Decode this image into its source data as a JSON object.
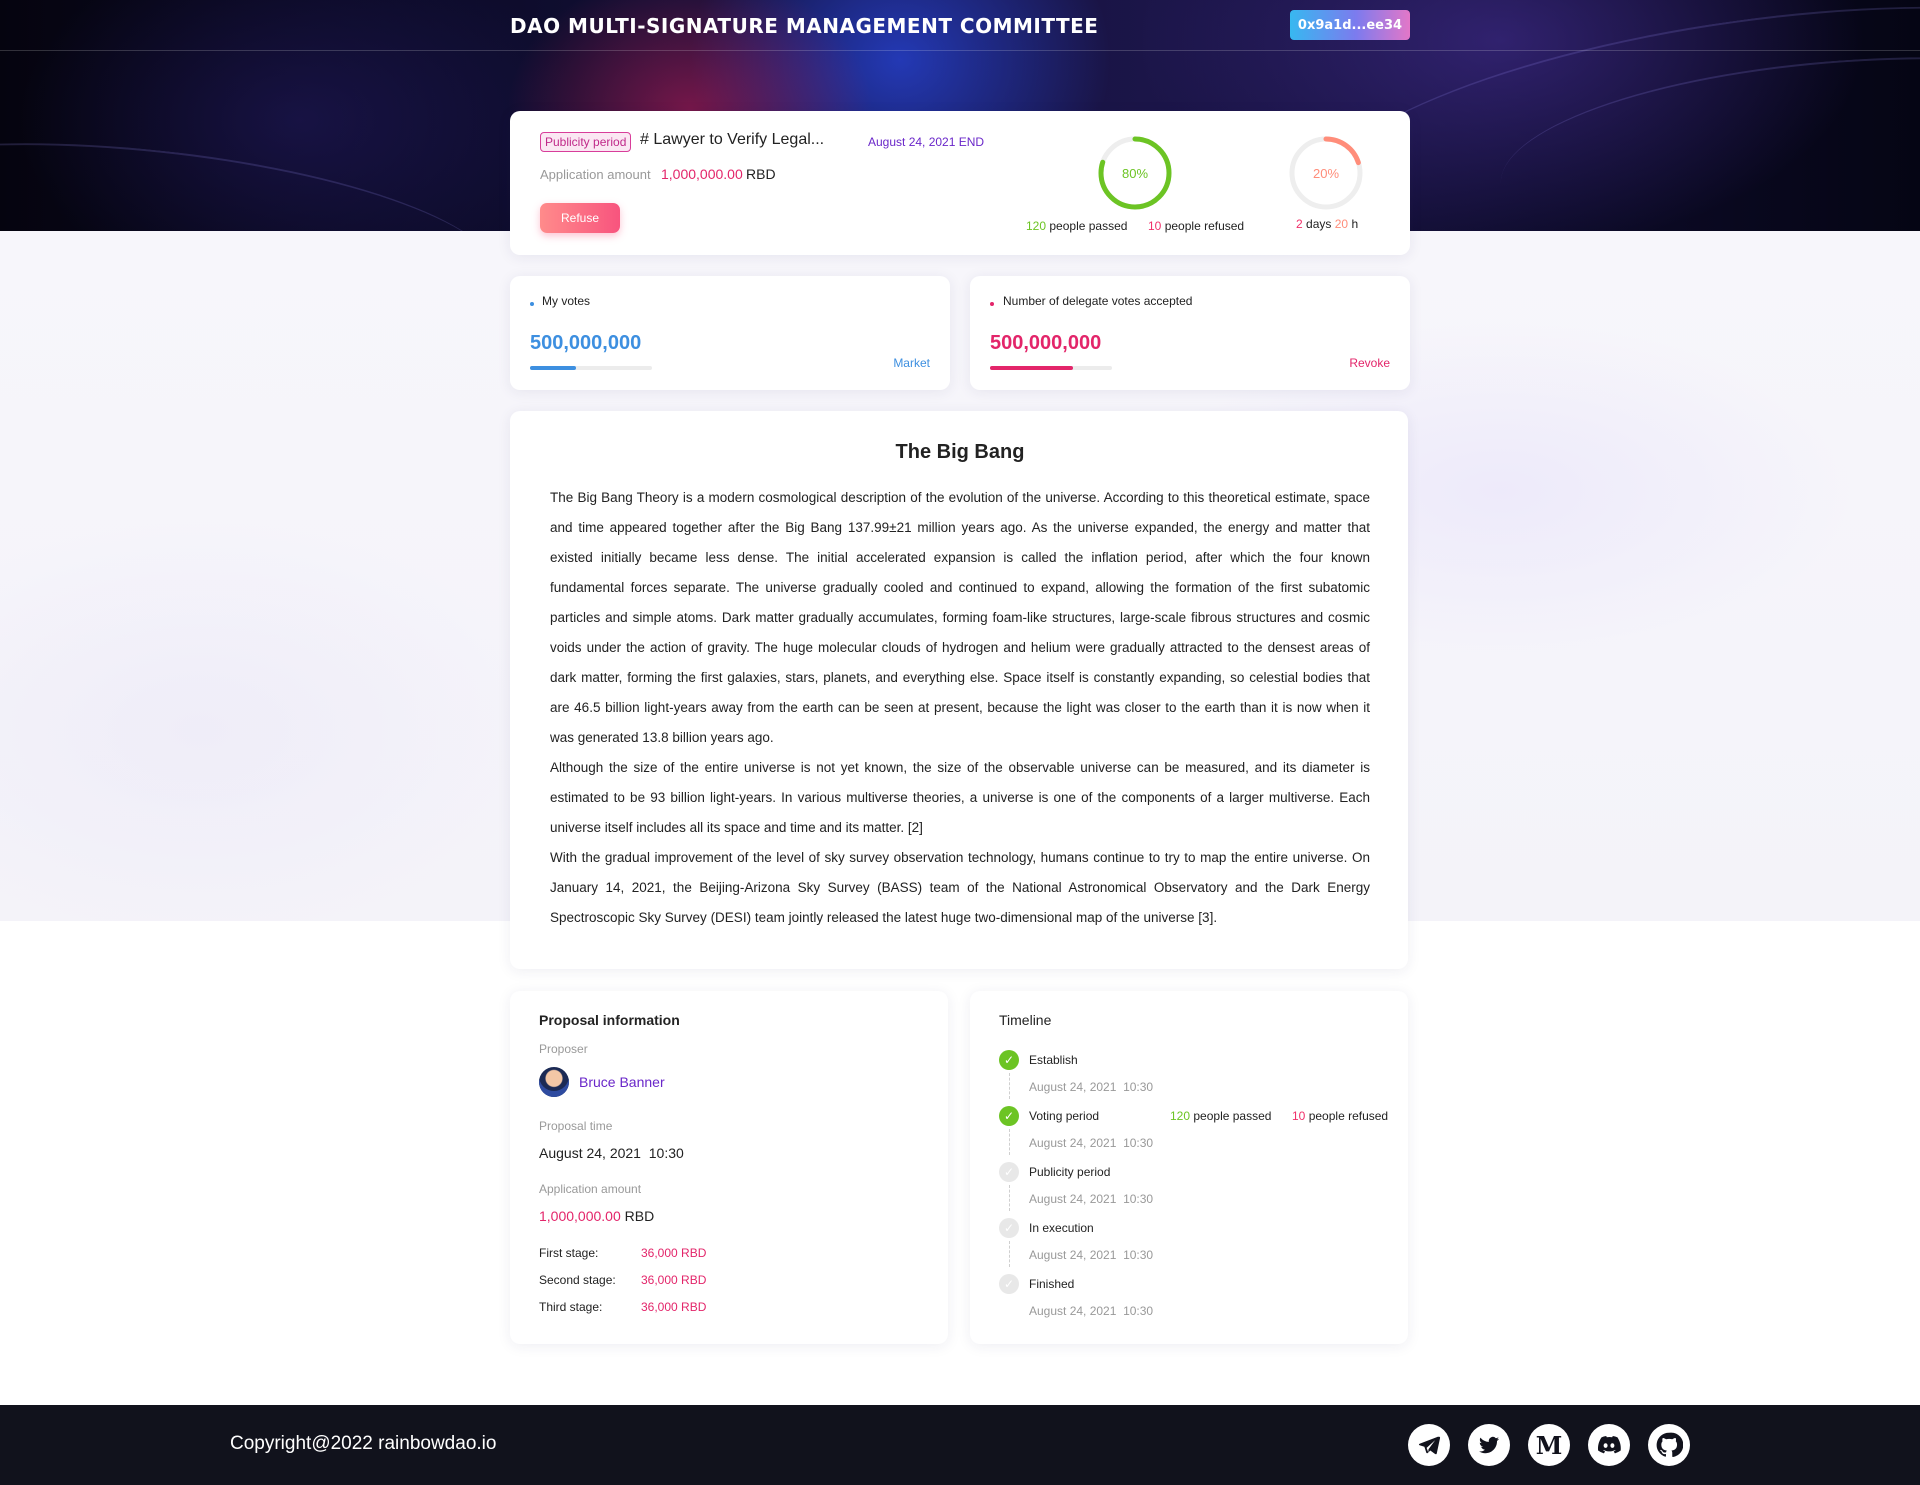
{
  "header": {
    "site_title": "DAO MULTI-SIGNATURE MANAGEMENT COMMITTEE",
    "wallet_address": "0x9a1d...ee34"
  },
  "proposal_card": {
    "status_tag": "Publicity period",
    "title": "# Lawyer to Verify Legal...",
    "end_date": "August 24, 2021 END",
    "application_label": "Application amount",
    "application_amount": "1,000,000.00",
    "application_unit": "RBD",
    "refuse_label": "Refuse",
    "pass_ring": {
      "percent_label": "80%",
      "percent": 80
    },
    "passed_count": "120",
    "passed_text": "people passed",
    "refused_count": "10",
    "refused_text": "people refused",
    "time_ring": {
      "percent_label": "20%",
      "percent": 20
    },
    "days_value": "2",
    "days_text": "days",
    "hours_value": "20",
    "hours_text": "h"
  },
  "my_votes": {
    "label": "My votes",
    "value": "500,000,000",
    "progress": 0.38,
    "link": "Market"
  },
  "delegate_votes": {
    "label": "Number of delegate votes accepted",
    "value": "500,000,000",
    "progress": 0.68,
    "link": "Revoke"
  },
  "article": {
    "title": "The Big Bang",
    "paragraphs": [
      "The Big Bang Theory is a modern cosmological description of the evolution of the universe. According to this theoretical estimate, space and time appeared together after the Big Bang 137.99±21 million years ago. As the universe expanded, the energy and matter that existed initially became less dense. The initial accelerated expansion is called the inflation period, after which the four known fundamental forces separate. The universe gradually cooled and continued to expand, allowing the formation of the first subatomic particles and simple atoms. Dark matter gradually accumulates, forming foam-like structures, large-scale fibrous structures and cosmic voids under the action of gravity. The huge molecular clouds of hydrogen and helium were gradually attracted to the densest areas of dark matter, forming the first galaxies, stars, planets, and everything else. Space itself is constantly expanding, so celestial bodies that are 46.5 billion light-years away from the earth can be seen at present, because the light was closer to the earth than it is now when it was generated 13.8 billion years ago.",
      "Although the size of the entire universe is not yet known, the size of the observable universe can be measured, and its diameter is estimated to be 93 billion light-years. In various multiverse theories, a universe is one of the components of a larger multiverse. Each universe itself includes all its space and time and its matter. [2]",
      "With the gradual improvement of the level of sky survey observation technology, humans continue to try to map the entire universe. On January 14, 2021, the Beijing-Arizona Sky Survey (BASS) team of the National Astronomical Observatory and the Dark Energy Spectroscopic Sky Survey (DESI) team jointly released the latest huge two-dimensional map of the universe [3]."
    ]
  },
  "proposal_info": {
    "title": "Proposal information",
    "proposer_label": "Proposer",
    "proposer_name": "Bruce Banner",
    "time_label": "Proposal time",
    "time_value": "August 24, 2021  10:30",
    "amount_label": "Application amount",
    "amount_value": "1,000,000.00",
    "amount_unit": "RBD",
    "stages": [
      {
        "label": "First stage:",
        "value": "36,000 RBD"
      },
      {
        "label": "Second stage:",
        "value": "36,000 RBD"
      },
      {
        "label": "Third stage:",
        "value": "36,000 RBD"
      }
    ]
  },
  "timeline": {
    "title": "Timeline",
    "steps": [
      {
        "name": "Establish",
        "time": "August 24, 2021  10:30",
        "done": true
      },
      {
        "name": "Voting period",
        "time": "August 24, 2021  10:30",
        "done": true,
        "passed_count": "120",
        "passed_text": "people passed",
        "refused_count": "10",
        "refused_text": "people refused"
      },
      {
        "name": "Publicity period",
        "time": "August 24, 2021  10:30",
        "done": false
      },
      {
        "name": "In execution",
        "time": "August 24, 2021  10:30",
        "done": false
      },
      {
        "name": "Finished",
        "time": "August 24, 2021  10:30",
        "done": false
      }
    ]
  },
  "footer": {
    "copyright": "Copyright@2022 rainbowdao.io",
    "social_icons": [
      "telegram-icon",
      "twitter-icon",
      "medium-icon",
      "discord-icon",
      "github-icon"
    ]
  },
  "colors": {
    "accent_purple": "#6a27c9",
    "amount_red": "#e3256a",
    "pass_green": "#6cc424",
    "vote_blue": "#3d8fe0",
    "footer_bg": "#11121c"
  }
}
